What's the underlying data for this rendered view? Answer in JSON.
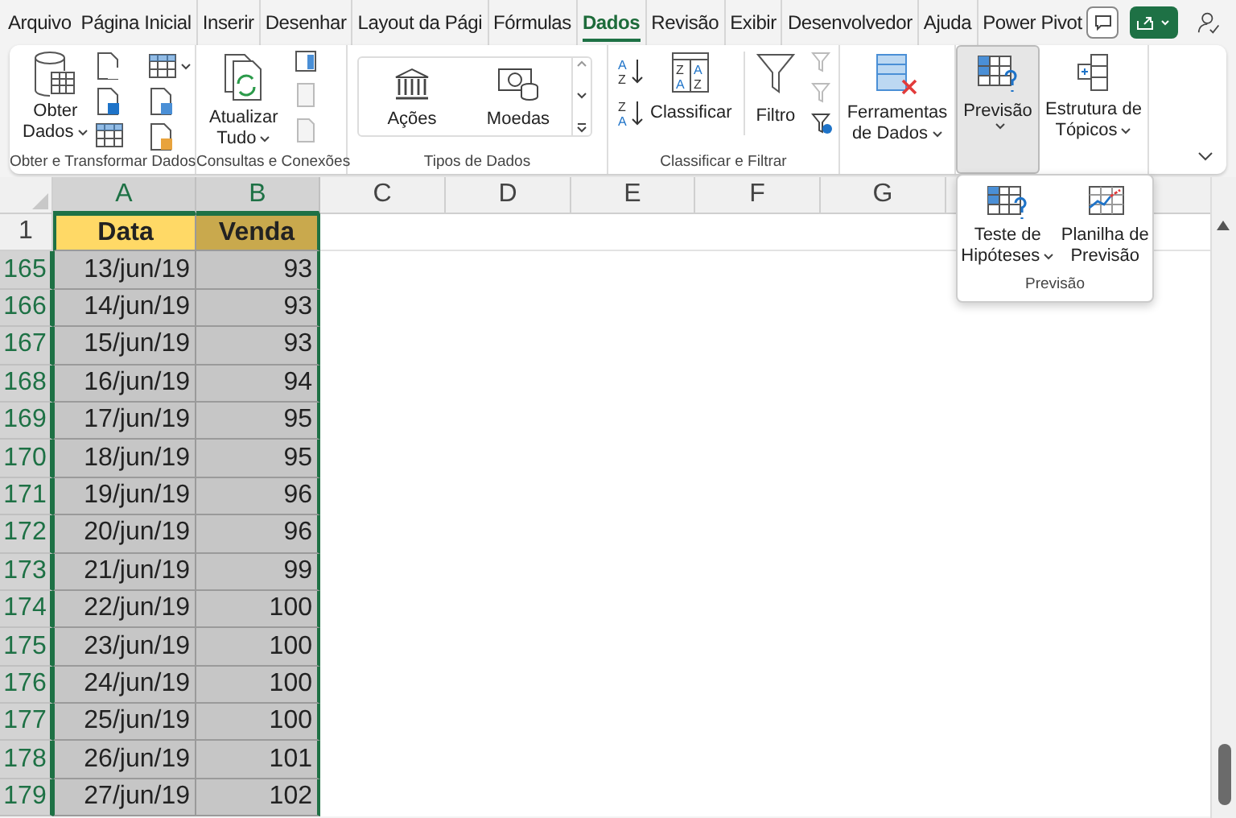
{
  "tabs": [
    {
      "label": "Arquivo",
      "selected": false
    },
    {
      "label": "Página Inicial",
      "selected": false
    },
    {
      "label": "Inserir",
      "selected": false
    },
    {
      "label": "Desenhar",
      "selected": false
    },
    {
      "label": "Layout da Pági",
      "selected": false
    },
    {
      "label": "Fórmulas",
      "selected": false
    },
    {
      "label": "Dados",
      "selected": true
    },
    {
      "label": "Revisão",
      "selected": false
    },
    {
      "label": "Exibir",
      "selected": false
    },
    {
      "label": "Desenvolvedor",
      "selected": false
    },
    {
      "label": "Ajuda",
      "selected": false
    },
    {
      "label": "Power Pivot",
      "selected": false
    }
  ],
  "ribbon": {
    "get_data": {
      "label1": "Obter",
      "label2": "Dados",
      "caption": "Obter e Transformar Dados"
    },
    "refresh": {
      "label1": "Atualizar",
      "label2": "Tudo",
      "caption": "Consultas e Conexões"
    },
    "data_types": {
      "items": [
        "Ações",
        "Moedas"
      ],
      "caption": "Tipos de Dados"
    },
    "sort_filter": {
      "asc_icon": [
        "A",
        "Z"
      ],
      "desc_icon": [
        "Z",
        "A"
      ],
      "dialog_icon": [
        "Z",
        "A",
        "A",
        "Z"
      ],
      "sort": "Classificar",
      "filter": "Filtro",
      "caption": "Classificar e Filtrar"
    },
    "tools": {
      "label1": "Ferramentas",
      "label2": "de Dados"
    },
    "forecast": {
      "label": "Previsão",
      "selected": true
    },
    "outline": {
      "label1": "Estrutura de",
      "label2": "Tópicos"
    }
  },
  "dropdown": {
    "items": [
      {
        "label1": "Teste de",
        "label2": "Hipóteses"
      },
      {
        "label1": "Planilha de",
        "label2": "Previsão"
      }
    ],
    "caption": "Previsão"
  },
  "columns": [
    {
      "label": "A",
      "selected": true
    },
    {
      "label": "B",
      "selected": true
    },
    {
      "label": "C",
      "selected": false
    },
    {
      "label": "D",
      "selected": false
    },
    {
      "label": "E",
      "selected": false
    },
    {
      "label": "F",
      "selected": false
    },
    {
      "label": "G",
      "selected": false
    }
  ],
  "header_row": {
    "number": "1",
    "cells": [
      "Data",
      "Venda"
    ]
  },
  "rows": [
    {
      "number": "165",
      "date": "13/jun/19",
      "value": "93",
      "selected": true
    },
    {
      "number": "166",
      "date": "14/jun/19",
      "value": "93",
      "selected": true
    },
    {
      "number": "167",
      "date": "15/jun/19",
      "value": "93",
      "selected": true
    },
    {
      "number": "168",
      "date": "16/jun/19",
      "value": "94",
      "selected": true
    },
    {
      "number": "169",
      "date": "17/jun/19",
      "value": "95",
      "selected": true
    },
    {
      "number": "170",
      "date": "18/jun/19",
      "value": "95",
      "selected": true
    },
    {
      "number": "171",
      "date": "19/jun/19",
      "value": "96",
      "selected": true
    },
    {
      "number": "172",
      "date": "20/jun/19",
      "value": "96",
      "selected": true
    },
    {
      "number": "173",
      "date": "21/jun/19",
      "value": "99",
      "selected": true
    },
    {
      "number": "174",
      "date": "22/jun/19",
      "value": "100",
      "selected": true
    },
    {
      "number": "175",
      "date": "23/jun/19",
      "value": "100",
      "selected": true
    },
    {
      "number": "176",
      "date": "24/jun/19",
      "value": "100",
      "selected": true
    },
    {
      "number": "177",
      "date": "25/jun/19",
      "value": "100",
      "selected": true
    },
    {
      "number": "178",
      "date": "26/jun/19",
      "value": "101",
      "selected": true
    },
    {
      "number": "179",
      "date": "27/jun/19",
      "value": "102",
      "selected": true
    }
  ]
}
